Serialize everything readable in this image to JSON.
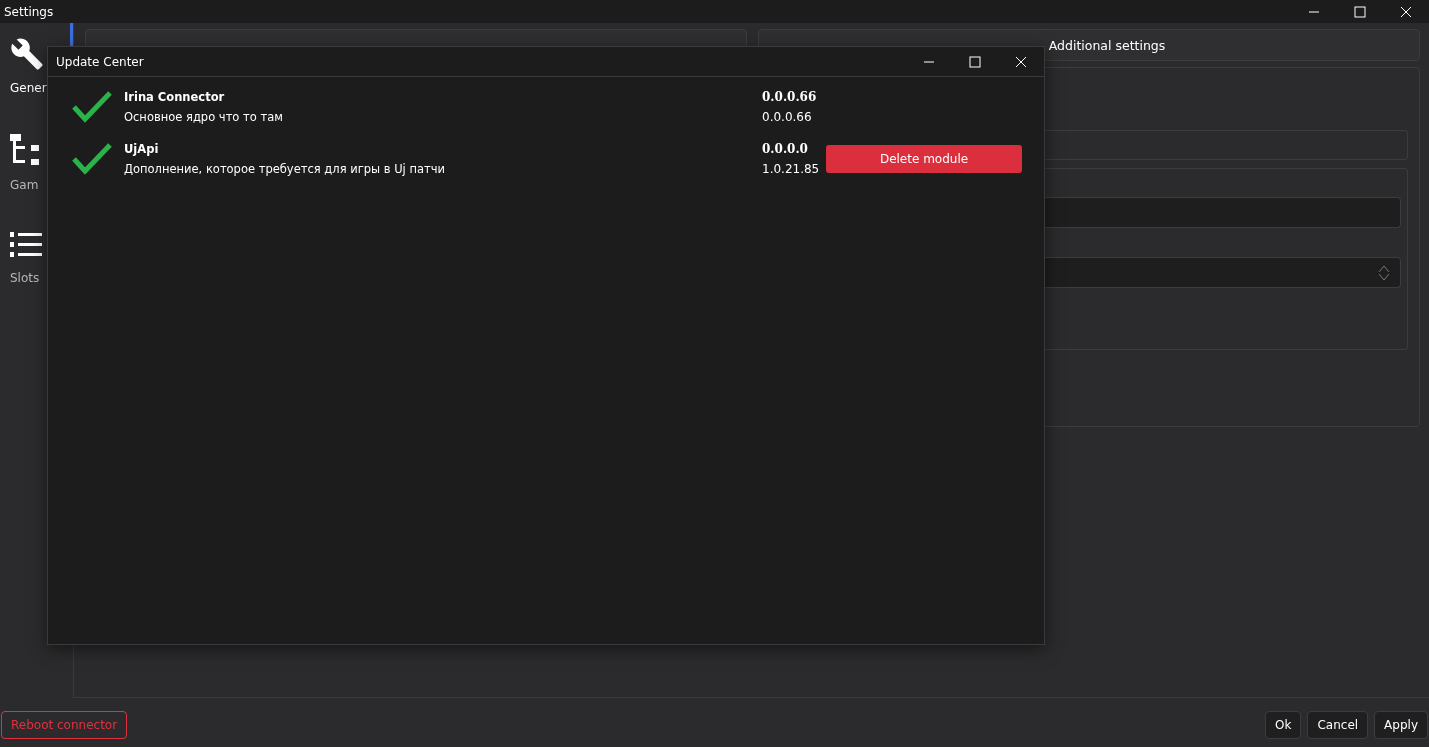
{
  "window": {
    "title": "Settings"
  },
  "sidebar": {
    "items": [
      {
        "kind": "wrench",
        "label": "Gener",
        "selected": true
      },
      {
        "kind": "tree",
        "label": "Gam",
        "selected": false
      },
      {
        "kind": "list",
        "label": "Slots",
        "selected": false
      }
    ]
  },
  "tabs": [
    {
      "label": "Additional settings"
    }
  ],
  "dialog": {
    "title": "Update Center",
    "modules": [
      {
        "installed": true,
        "name": "Irina Connector",
        "description": "Основное ядро что то там",
        "latest_version": "0.0.0.66",
        "installed_version": "0.0.0.66"
      },
      {
        "installed": true,
        "name": "UjApi",
        "description": "Дополнение, которое требуется для игры в Uj патчи",
        "latest_version": "0.0.0.0",
        "installed_version": "1.0.21.85",
        "action": "Delete module"
      }
    ]
  },
  "footer": {
    "reboot": "Reboot connector",
    "buttons": [
      "Ok",
      "Cancel",
      "Apply"
    ]
  }
}
